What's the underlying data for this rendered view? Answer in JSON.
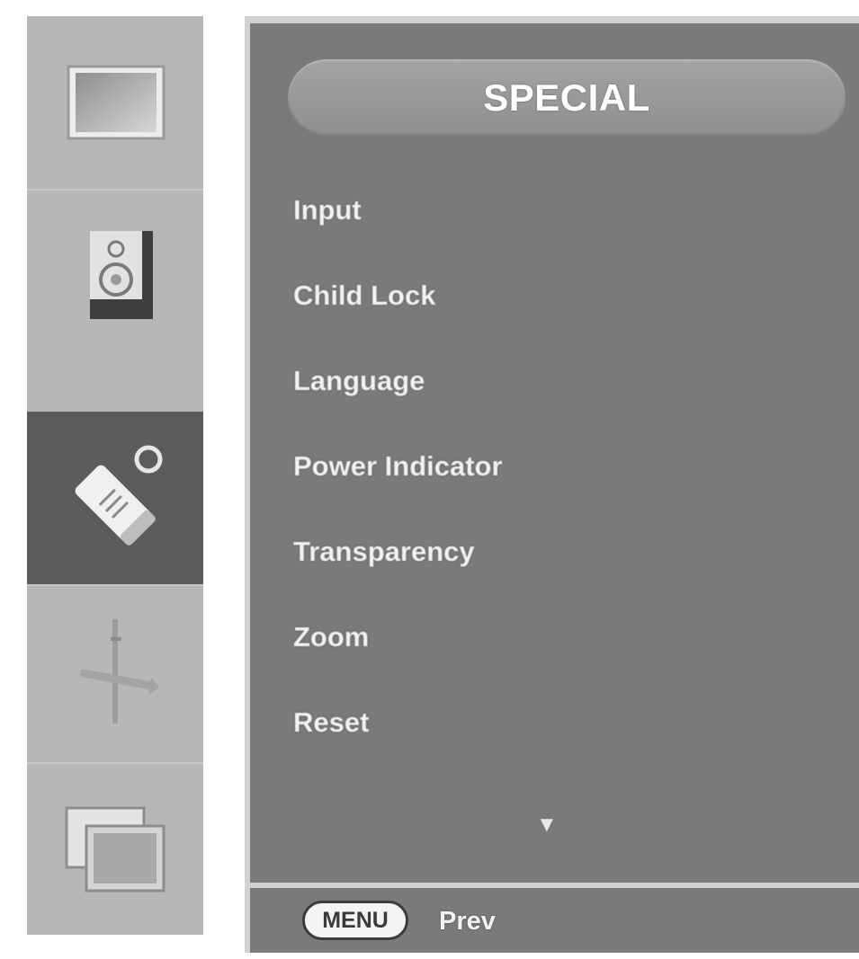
{
  "menu": {
    "title": "SPECIAL",
    "items": [
      {
        "label": "Input"
      },
      {
        "label": "Child Lock"
      },
      {
        "label": "Language"
      },
      {
        "label": "Power Indicator"
      },
      {
        "label": "Transparency"
      },
      {
        "label": "Zoom"
      },
      {
        "label": "Reset"
      }
    ],
    "scroll_indicator": "▼"
  },
  "sidebar": {
    "tabs": [
      {
        "icon": "picture-icon",
        "active": false
      },
      {
        "icon": "speaker-icon",
        "active": false
      },
      {
        "icon": "tag-icon",
        "active": true
      },
      {
        "icon": "screen-adjust-icon",
        "active": false
      },
      {
        "icon": "pip-icon",
        "active": false
      }
    ]
  },
  "footer": {
    "key_label": "MENU",
    "hint": "Prev"
  },
  "colors": {
    "panel_bg": "#7a7a7a",
    "sidebar_bg": "#b7b7b7",
    "sidebar_active_bg": "#5c5c5c",
    "text": "#f2f2f2"
  }
}
